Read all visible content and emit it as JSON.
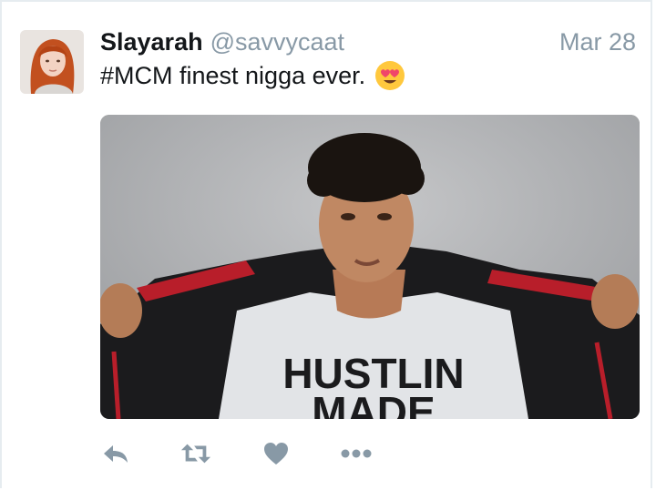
{
  "tweet": {
    "author_name": "Slayarah",
    "author_handle": "@savvycaat",
    "date": "Mar 28",
    "text": "#MCM finest nigga ever.",
    "emoji": "heart-eyes-emoji",
    "media": {
      "shirt_text_line1": "HUSTLIN",
      "shirt_text_line2": "MADE"
    }
  },
  "actions": [
    {
      "name": "reply-icon"
    },
    {
      "name": "retweet-icon"
    },
    {
      "name": "like-icon"
    },
    {
      "name": "more-icon"
    }
  ],
  "colors": {
    "name": "#14171a",
    "muted": "#8899a6",
    "icon": "#8899a6",
    "border": "#e6ecf0"
  }
}
